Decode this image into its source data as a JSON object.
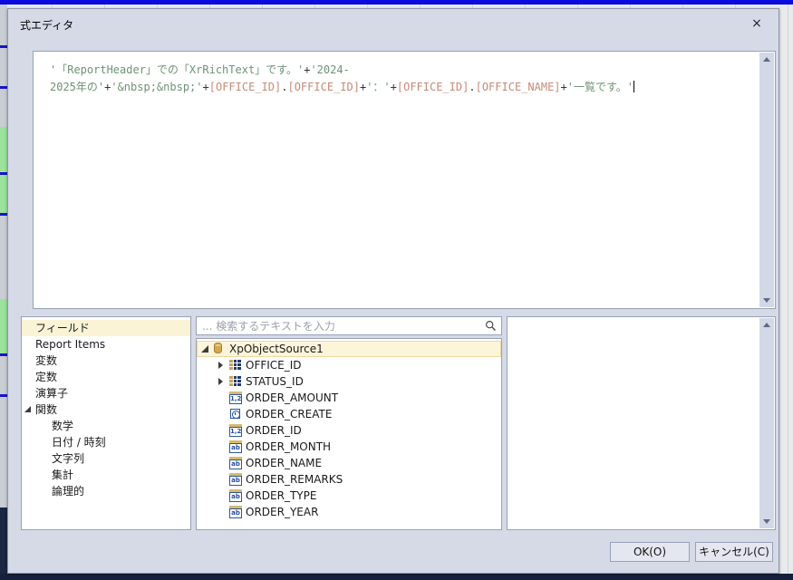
{
  "window": {
    "title": "式エディタ",
    "close_label": "×"
  },
  "colors": {
    "dialog_bg": "#d6dae7",
    "string_token": "#6e9375",
    "field_token": "#c68a76",
    "operator_token": "#333333",
    "selection_cream": "#fbf3d5",
    "top_bar_blue": "#0b0bdf",
    "bottom_bar_navy": "#16203c"
  },
  "editor": {
    "lines": [
      [
        {
          "type": "string",
          "text": "'「ReportHeader」での「XrRichText」です。'"
        },
        {
          "type": "operator",
          "text": "+"
        },
        {
          "type": "string",
          "text": "'2024-"
        }
      ],
      [
        {
          "type": "string",
          "text": "2025年の'"
        },
        {
          "type": "operator",
          "text": "+"
        },
        {
          "type": "string",
          "text": "'&nbsp;&nbsp;'"
        },
        {
          "type": "operator",
          "text": "+"
        },
        {
          "type": "field",
          "text": "[OFFICE_ID]"
        },
        {
          "type": "operator",
          "text": "."
        },
        {
          "type": "field",
          "text": "[OFFICE_ID]"
        },
        {
          "type": "operator",
          "text": "+"
        },
        {
          "type": "string",
          "text": "'：'"
        },
        {
          "type": "operator",
          "text": "+"
        },
        {
          "type": "field",
          "text": "[OFFICE_ID]"
        },
        {
          "type": "operator",
          "text": "."
        },
        {
          "type": "field",
          "text": "[OFFICE_NAME]"
        },
        {
          "type": "operator",
          "text": "+"
        },
        {
          "type": "string",
          "text": "'一覧です。'"
        }
      ]
    ]
  },
  "categories": {
    "items": [
      {
        "label": "フィールド",
        "level": 0,
        "selected": true,
        "expander": "none"
      },
      {
        "label": "Report Items",
        "level": 0,
        "selected": false,
        "expander": "none"
      },
      {
        "label": "変数",
        "level": 0,
        "selected": false,
        "expander": "none"
      },
      {
        "label": "定数",
        "level": 0,
        "selected": false,
        "expander": "none"
      },
      {
        "label": "演算子",
        "level": 0,
        "selected": false,
        "expander": "none"
      },
      {
        "label": "関数",
        "level": 0,
        "selected": false,
        "expander": "expanded"
      },
      {
        "label": "数学",
        "level": 1,
        "selected": false,
        "expander": "none"
      },
      {
        "label": "日付 / 時刻",
        "level": 1,
        "selected": false,
        "expander": "none"
      },
      {
        "label": "文字列",
        "level": 1,
        "selected": false,
        "expander": "none"
      },
      {
        "label": "集計",
        "level": 1,
        "selected": false,
        "expander": "none"
      },
      {
        "label": "論理的",
        "level": 1,
        "selected": false,
        "expander": "none"
      }
    ]
  },
  "search": {
    "placeholder": "... 検索するテキストを入力"
  },
  "tree": {
    "items": [
      {
        "label": "XpObjectSource1",
        "level": 0,
        "icon": "datasource",
        "expander": "expanded",
        "selected": true
      },
      {
        "label": "OFFICE_ID",
        "level": 1,
        "icon": "table",
        "expander": "collapsed",
        "selected": false
      },
      {
        "label": "STATUS_ID",
        "level": 1,
        "icon": "table",
        "expander": "collapsed",
        "selected": false
      },
      {
        "label": "ORDER_AMOUNT",
        "level": 1,
        "icon": "numeric",
        "expander": "none",
        "selected": false
      },
      {
        "label": "ORDER_CREATE",
        "level": 1,
        "icon": "datetime",
        "expander": "none",
        "selected": false
      },
      {
        "label": "ORDER_ID",
        "level": 1,
        "icon": "numeric",
        "expander": "none",
        "selected": false
      },
      {
        "label": "ORDER_MONTH",
        "level": 1,
        "icon": "text",
        "expander": "none",
        "selected": false
      },
      {
        "label": "ORDER_NAME",
        "level": 1,
        "icon": "text",
        "expander": "none",
        "selected": false
      },
      {
        "label": "ORDER_REMARKS",
        "level": 1,
        "icon": "text",
        "expander": "none",
        "selected": false
      },
      {
        "label": "ORDER_TYPE",
        "level": 1,
        "icon": "text",
        "expander": "none",
        "selected": false
      },
      {
        "label": "ORDER_YEAR",
        "level": 1,
        "icon": "text",
        "expander": "none",
        "selected": false
      }
    ]
  },
  "footer": {
    "ok_label": "OK(O)",
    "cancel_label": "キャンセル(C)"
  }
}
